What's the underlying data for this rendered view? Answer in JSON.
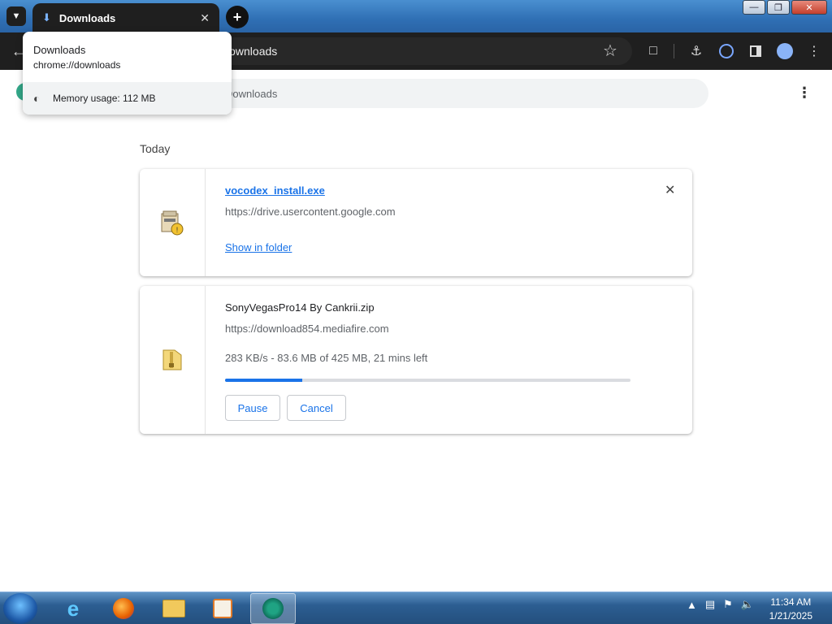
{
  "browser": {
    "active_tab_title": "Downloads",
    "omnibox_text": "Downloads"
  },
  "hovercard": {
    "title": "Downloads",
    "url": "chrome://downloads",
    "memory": "Memory usage: 112 MB"
  },
  "page": {
    "search_placeholder": "Downloads",
    "section_label": "Today",
    "downloads": [
      {
        "filename": "vocodex_install.exe",
        "url": "https://drive.usercontent.google.com",
        "action_link": "Show in folder"
      },
      {
        "filename": "SonyVegasPro14 By Cankrii.zip",
        "url": "https://download854.mediafire.com",
        "status": "283 KB/s - 83.6 MB of 425 MB, 21 mins left",
        "progress": 0.19,
        "pause_label": "Pause",
        "cancel_label": "Cancel"
      }
    ]
  },
  "taskbar": {
    "time": "11:34 AM",
    "date": "1/21/2025"
  },
  "colors": {
    "accent": "#1a73e8",
    "toolbar": "#1f1f1f"
  }
}
